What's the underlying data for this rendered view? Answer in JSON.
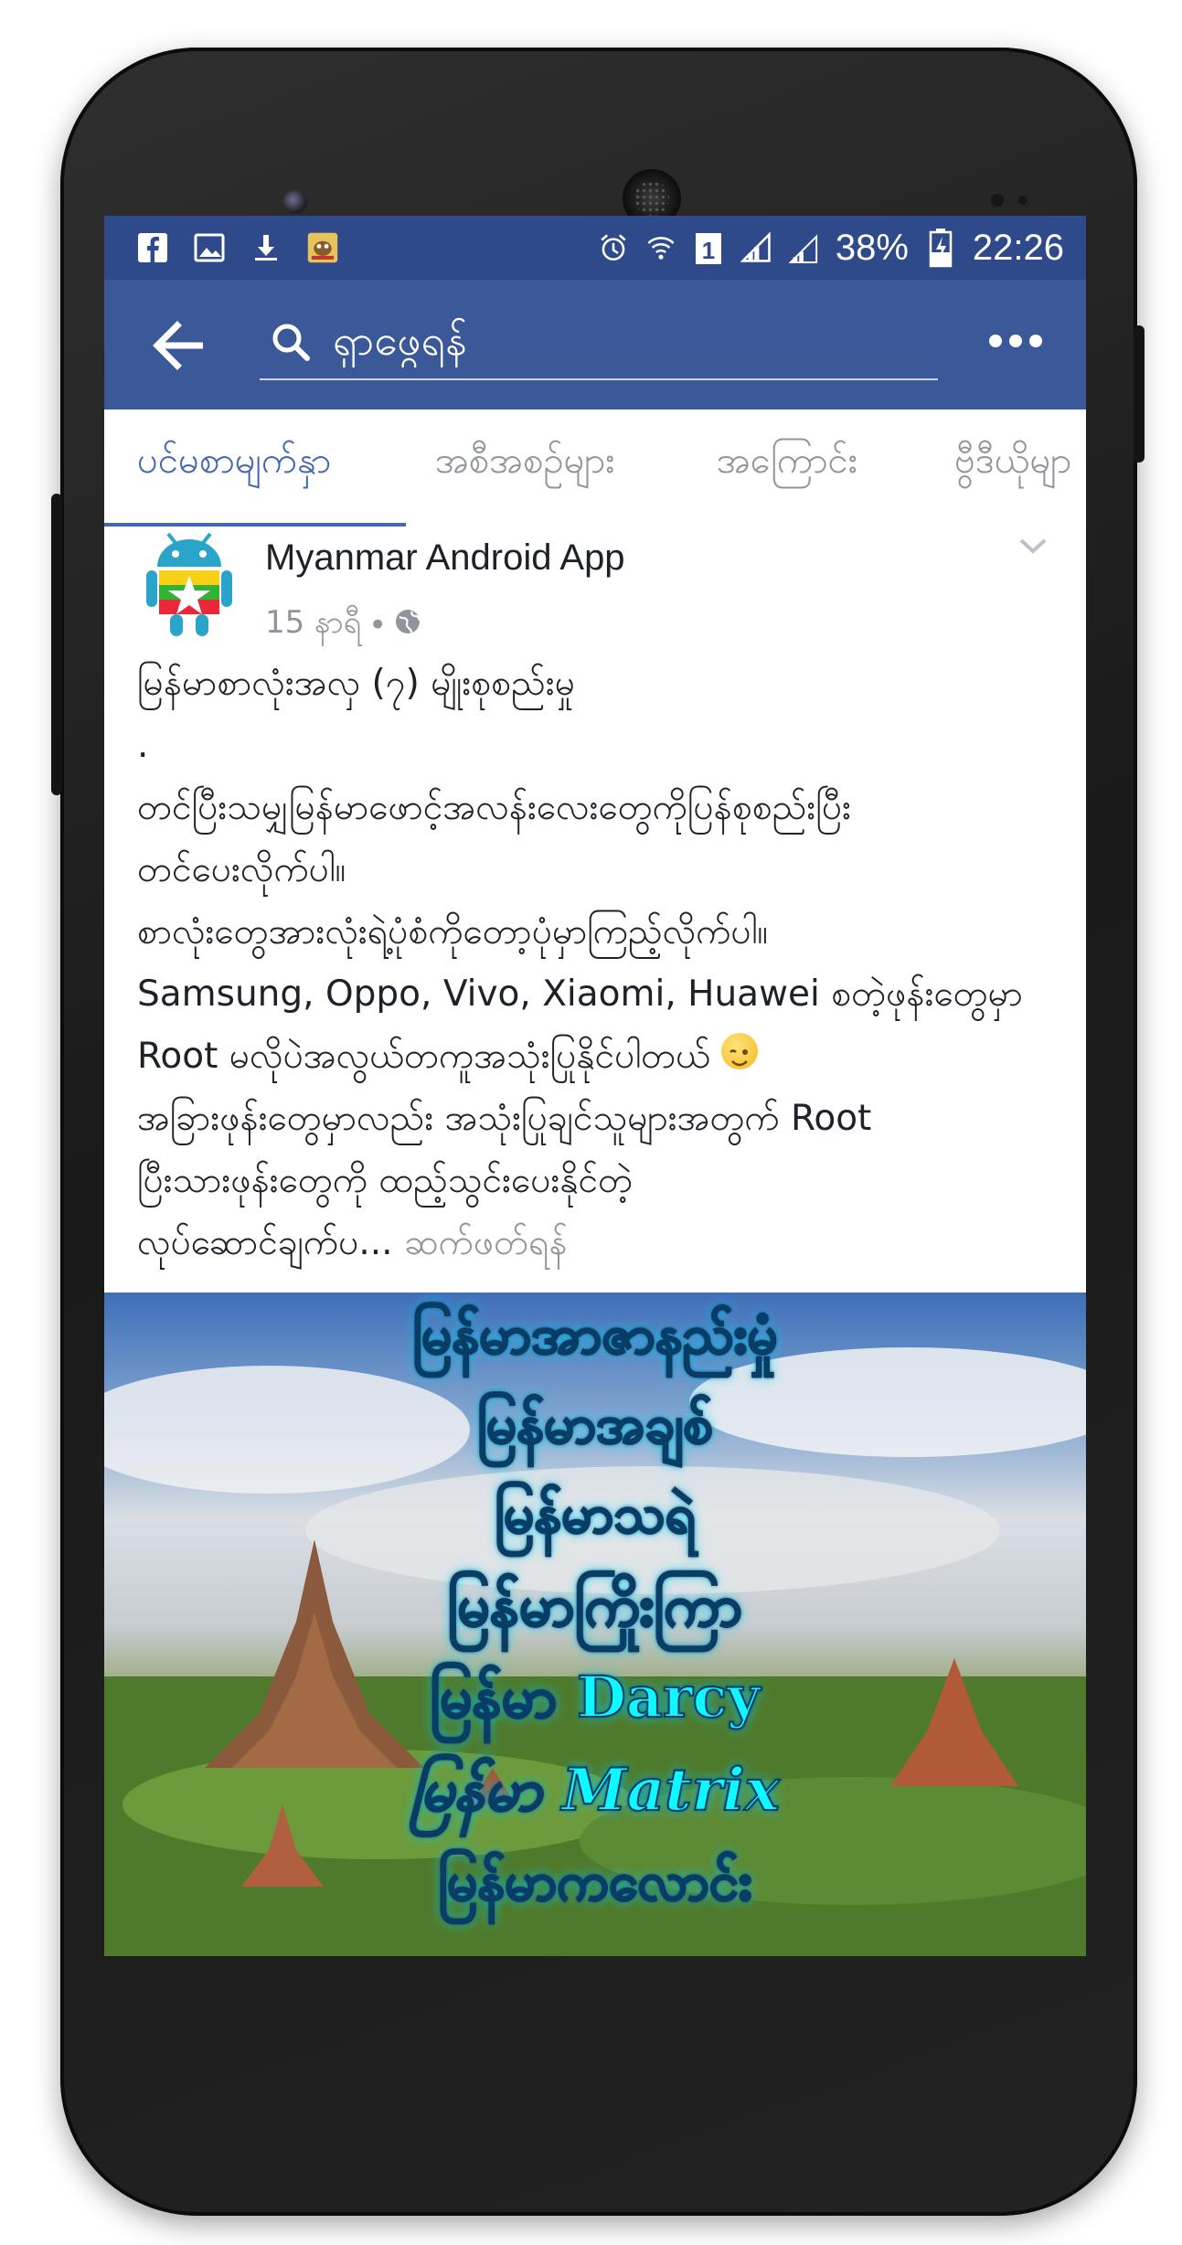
{
  "status_bar": {
    "battery": "38%",
    "time": "22:26",
    "sim_slot": "1",
    "left_icons": [
      "facebook-icon",
      "image-icon",
      "download-icon",
      "app-notification-icon"
    ],
    "right_icons": [
      "alarm-icon",
      "wifi-icon",
      "sim-icon",
      "signal-icon",
      "signal-icon",
      "battery-icon"
    ]
  },
  "toolbar": {
    "search_placeholder": "ရှာဖွေရန်",
    "colors": {
      "toolbar": "#3b5998",
      "status_bar": "#2e4a8a"
    }
  },
  "tabs": [
    {
      "label": "ပင်မစာမျက်နှာ",
      "active": true
    },
    {
      "label": "အစီအစဉ်များ",
      "active": false
    },
    {
      "label": "အကြောင်း",
      "active": false
    },
    {
      "label": "ဗွီဒီယိုမျာ",
      "active": false
    }
  ],
  "post": {
    "page_name": "Myanmar Android App",
    "time": "15 နာရီ",
    "separator": "•",
    "visibility_icon": "globe-icon",
    "lines": [
      "မြန်မာစာလုံးအလှ (၇) မျိုးစုစည်းမှု",
      ".",
      "တင်ပြီးသမျှမြန်မာဖောင့်အလန်းလေးတွေကိုပြန်စုစည်းပြီး",
      "တင်ပေးလိုက်ပါ။",
      "စာလုံးတွေအားလုံးရဲ့ပုံစံကိုတော့ပုံမှာကြည့်လိုက်ပါ။",
      "Samsung, Oppo, Vivo, Xiaomi, Huawei စတဲ့ဖုန်းတွေမှာ",
      "Root မလိုပဲအလွယ်တကူအသုံးပြုနိုင်ပါတယ်",
      "အခြားဖုန်းတွေမှာလည်း အသုံးပြုချင်သူများအတွက် Root",
      "ပြီးသားဖုန်းတွေကို ထည့်သွင်းပေးနိုင်တဲ့",
      "လုပ်ဆောင်ချက်ပ..."
    ],
    "see_more": "ဆက်ဖတ်ရန်",
    "emoji": "wink-emoji-icon"
  },
  "photo": {
    "lines": [
      "မြန်မာအာဇာနည်းမှုံ",
      "မြန်မာအချစ်",
      "မြန်မာသရဲ",
      "မြန်မာကြိုးကြာ",
      "မြန်မာ Darcy",
      "မြန်မာ Matrix",
      "မြန်မာကလောင်း"
    ]
  }
}
